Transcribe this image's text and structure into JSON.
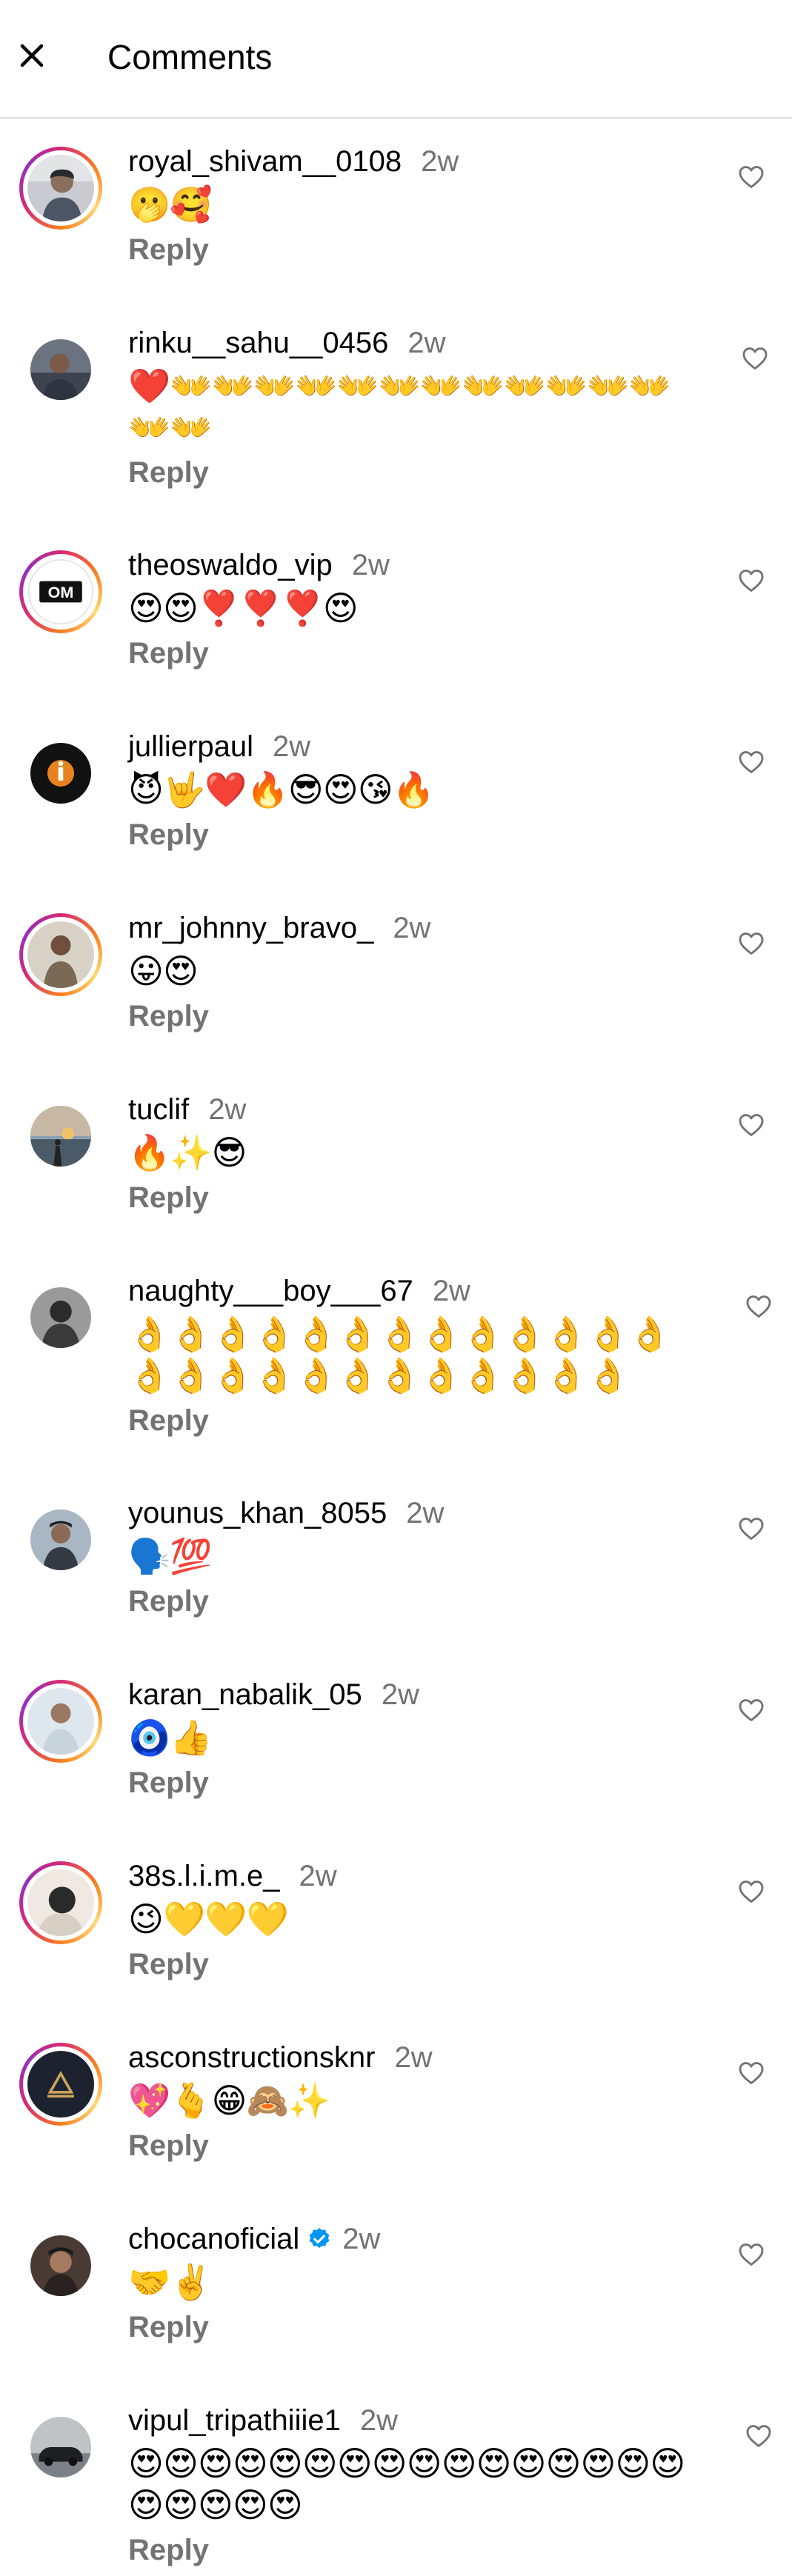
{
  "header": {
    "title": "Comments",
    "close_icon": "close-icon"
  },
  "colors": {
    "username": "#000000",
    "timestamp": "#737373",
    "reply": "#737373",
    "divider": "#dbdbdb",
    "verified": "#0095f6",
    "story_ring": [
      "#d62976",
      "#fa7e1e",
      "#feda75",
      "#962fbf"
    ]
  },
  "reply_label": "Reply",
  "comments": [
    {
      "username": "royal_shivam__0108",
      "time": "2w",
      "text": "🫢🥰",
      "verified": false,
      "story_ring": true,
      "avatar_icon": "person-avatar"
    },
    {
      "username": "rinku__sahu__0456",
      "time": "2w",
      "text": "❤️👐👐👐👐👐👐👐👐👐👐👐👐👐👐",
      "verified": false,
      "story_ring": false,
      "avatar_icon": "person-avatar"
    },
    {
      "username": "theoswaldo_vip",
      "time": "2w",
      "text": "😍😍❣️❣️❣️😍",
      "verified": false,
      "story_ring": true,
      "avatar_icon": "om-logo-avatar"
    },
    {
      "username": "jullierpaul",
      "time": "2w",
      "text": "😈🤟❤️🔥😎😍😘🔥",
      "verified": false,
      "story_ring": false,
      "avatar_icon": "brand-logo-avatar"
    },
    {
      "username": "mr_johnny_bravo_",
      "time": "2w",
      "text": "😛😍",
      "verified": false,
      "story_ring": true,
      "avatar_icon": "person-avatar"
    },
    {
      "username": "tuclif",
      "time": "2w",
      "text": "🔥✨😎",
      "verified": false,
      "story_ring": false,
      "avatar_icon": "sunset-avatar"
    },
    {
      "username": "naughty___boy___67",
      "time": "2w",
      "text": "👌👌👌👌👌👌👌👌👌👌👌👌👌👌👌👌👌👌👌👌👌👌👌👌👌",
      "verified": false,
      "story_ring": false,
      "avatar_icon": "person-avatar"
    },
    {
      "username": "younus_khan_8055",
      "time": "2w",
      "text": "🗣️💯",
      "verified": false,
      "story_ring": false,
      "avatar_icon": "person-avatar"
    },
    {
      "username": "karan_nabalik_05",
      "time": "2w",
      "text": "🧿👍",
      "verified": false,
      "story_ring": true,
      "avatar_icon": "person-avatar"
    },
    {
      "username": "38s.l.i.m.e_",
      "time": "2w",
      "text": "😉💛💛💛",
      "verified": false,
      "story_ring": true,
      "avatar_icon": "person-avatar"
    },
    {
      "username": "asconstructionsknr",
      "time": "2w",
      "text": "💖🫰😁🙈✨",
      "verified": false,
      "story_ring": true,
      "avatar_icon": "logo-avatar"
    },
    {
      "username": "chocanoficial",
      "time": "2w",
      "text": "🤝✌️",
      "verified": true,
      "story_ring": false,
      "avatar_icon": "person-avatar"
    },
    {
      "username": "vipul_tripathiiie1",
      "time": "2w",
      "text": "😍😍😍😍😍😍😍😍😍😍😍😍😍😍😍😍😍😍😍😍😍",
      "verified": false,
      "story_ring": false,
      "avatar_icon": "car-avatar"
    }
  ]
}
